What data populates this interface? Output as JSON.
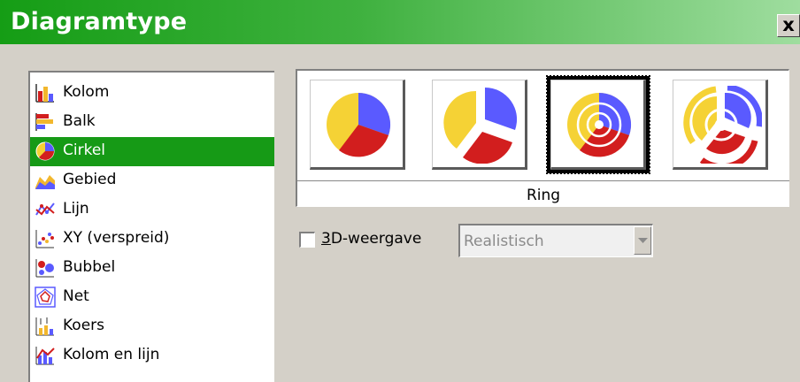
{
  "dialog": {
    "title": "Diagramtype",
    "close_label": "x"
  },
  "chart_types": [
    {
      "label": "Kolom",
      "icon": "column-chart-icon",
      "selected": false
    },
    {
      "label": "Balk",
      "icon": "bar-chart-icon",
      "selected": false
    },
    {
      "label": "Cirkel",
      "icon": "pie-chart-icon",
      "selected": true
    },
    {
      "label": "Gebied",
      "icon": "area-chart-icon",
      "selected": false
    },
    {
      "label": "Lijn",
      "icon": "line-chart-icon",
      "selected": false
    },
    {
      "label": "XY (verspreid)",
      "icon": "scatter-chart-icon",
      "selected": false
    },
    {
      "label": "Bubbel",
      "icon": "bubble-chart-icon",
      "selected": false
    },
    {
      "label": "Net",
      "icon": "net-chart-icon",
      "selected": false
    },
    {
      "label": "Koers",
      "icon": "stock-chart-icon",
      "selected": false
    },
    {
      "label": "Kolom en lijn",
      "icon": "column-line-chart-icon",
      "selected": false
    }
  ],
  "variants": {
    "items": [
      {
        "icon": "pie-variant-icon",
        "selected": false
      },
      {
        "icon": "exploded-pie-variant-icon",
        "selected": false
      },
      {
        "icon": "ring-variant-icon",
        "selected": true
      },
      {
        "icon": "exploded-ring-variant-icon",
        "selected": false
      }
    ],
    "selected_name": "Ring"
  },
  "options": {
    "three_d_label_accel": "3",
    "three_d_label_rest": "D-weergave",
    "three_d_checked": false,
    "style_value": "Realistisch"
  },
  "colors": {
    "title_bar": "#159d15",
    "selection": "#169a16",
    "slice_yellow": "#f5d235",
    "slice_blue": "#5a5aff",
    "slice_red": "#d21e1e"
  }
}
